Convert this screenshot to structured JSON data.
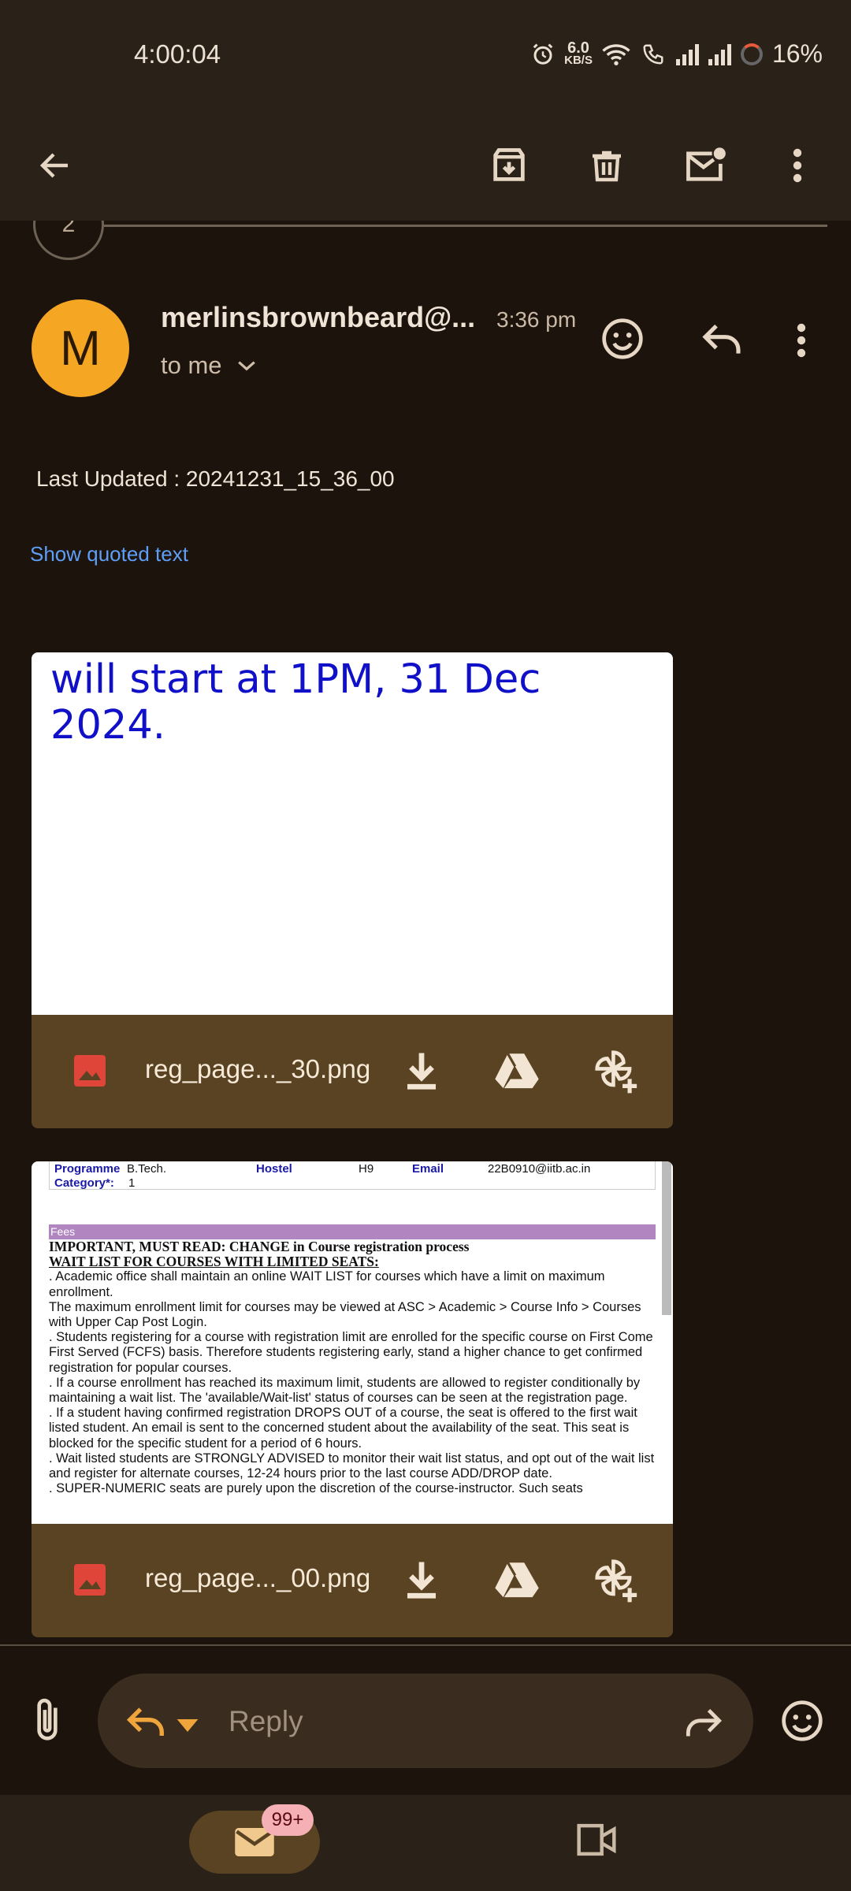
{
  "status_bar": {
    "time": "4:00:04",
    "speed_value": "6.0",
    "speed_unit": "KB/S",
    "battery": "16%"
  },
  "toolbar": {
    "back_icon": "arrow-left-icon",
    "archive_icon": "archive-icon",
    "delete_icon": "trash-icon",
    "unread_icon": "mark-unread-icon",
    "more_icon": "more-vert-icon"
  },
  "thread": {
    "count": "2"
  },
  "message": {
    "avatar_letter": "M",
    "avatar_color": "#f5a623",
    "sender": "merlinsbrownbeard@...",
    "time": "3:36 pm",
    "recipient": "to me",
    "body_line": "Last Updated : 20241231_15_36_00",
    "show_quoted": "Show quoted text"
  },
  "attachments": [
    {
      "name": "reg_page..._30.png",
      "preview_text": "will start at 1PM, 31 Dec 2024."
    },
    {
      "name": "reg_page..._00.png",
      "preview": {
        "programme_label": "Programme",
        "programme_value": "B.Tech.",
        "hostel_label": "Hostel",
        "hostel_value": "H9",
        "email_label": "Email",
        "email_value": "22B0910@iitb.ac.in",
        "category_label": "Category*:",
        "category_value": "1",
        "fees": "Fees",
        "important": "IMPORTANT, MUST READ: CHANGE in Course registration process",
        "waitlist_title": "WAIT LIST FOR COURSES WITH LIMITED SEATS:",
        "para1": ". Academic office shall maintain an online WAIT LIST for courses which have a limit on maximum enrollment.",
        "para2": "The maximum enrollment limit for courses may be viewed at ASC > Academic > Course Info > Courses with Upper Cap Post Login.",
        "para3": ". Students registering for a course with registration limit are enrolled for the specific course on First Come First Served (FCFS) basis. Therefore students registering early, stand a higher chance to get confirmed registration for popular courses.",
        "para4": ". If a course enrollment has reached its maximum limit, students are allowed to register conditionally by maintaining a wait list. The 'available/Wait-list' status of courses can be seen at the registration page.",
        "para5": ". If a student having confirmed registration DROPS OUT of a course, the seat is offered to the first wait listed student. An email is sent to the concerned student about the availability of the seat. This seat is blocked for the specific student for a period of 6 hours.",
        "para6": ". Wait listed students are STRONGLY ADVISED to monitor their wait list status, and opt out of the wait list and register for alternate courses, 12-24 hours prior to the last course ADD/DROP date.",
        "para7": ". SUPER-NUMERIC seats are purely upon the discretion of the course-instructor. Such seats"
      }
    }
  ],
  "reply_bar": {
    "placeholder": "Reply"
  },
  "nav": {
    "mail_badge": "99+"
  }
}
